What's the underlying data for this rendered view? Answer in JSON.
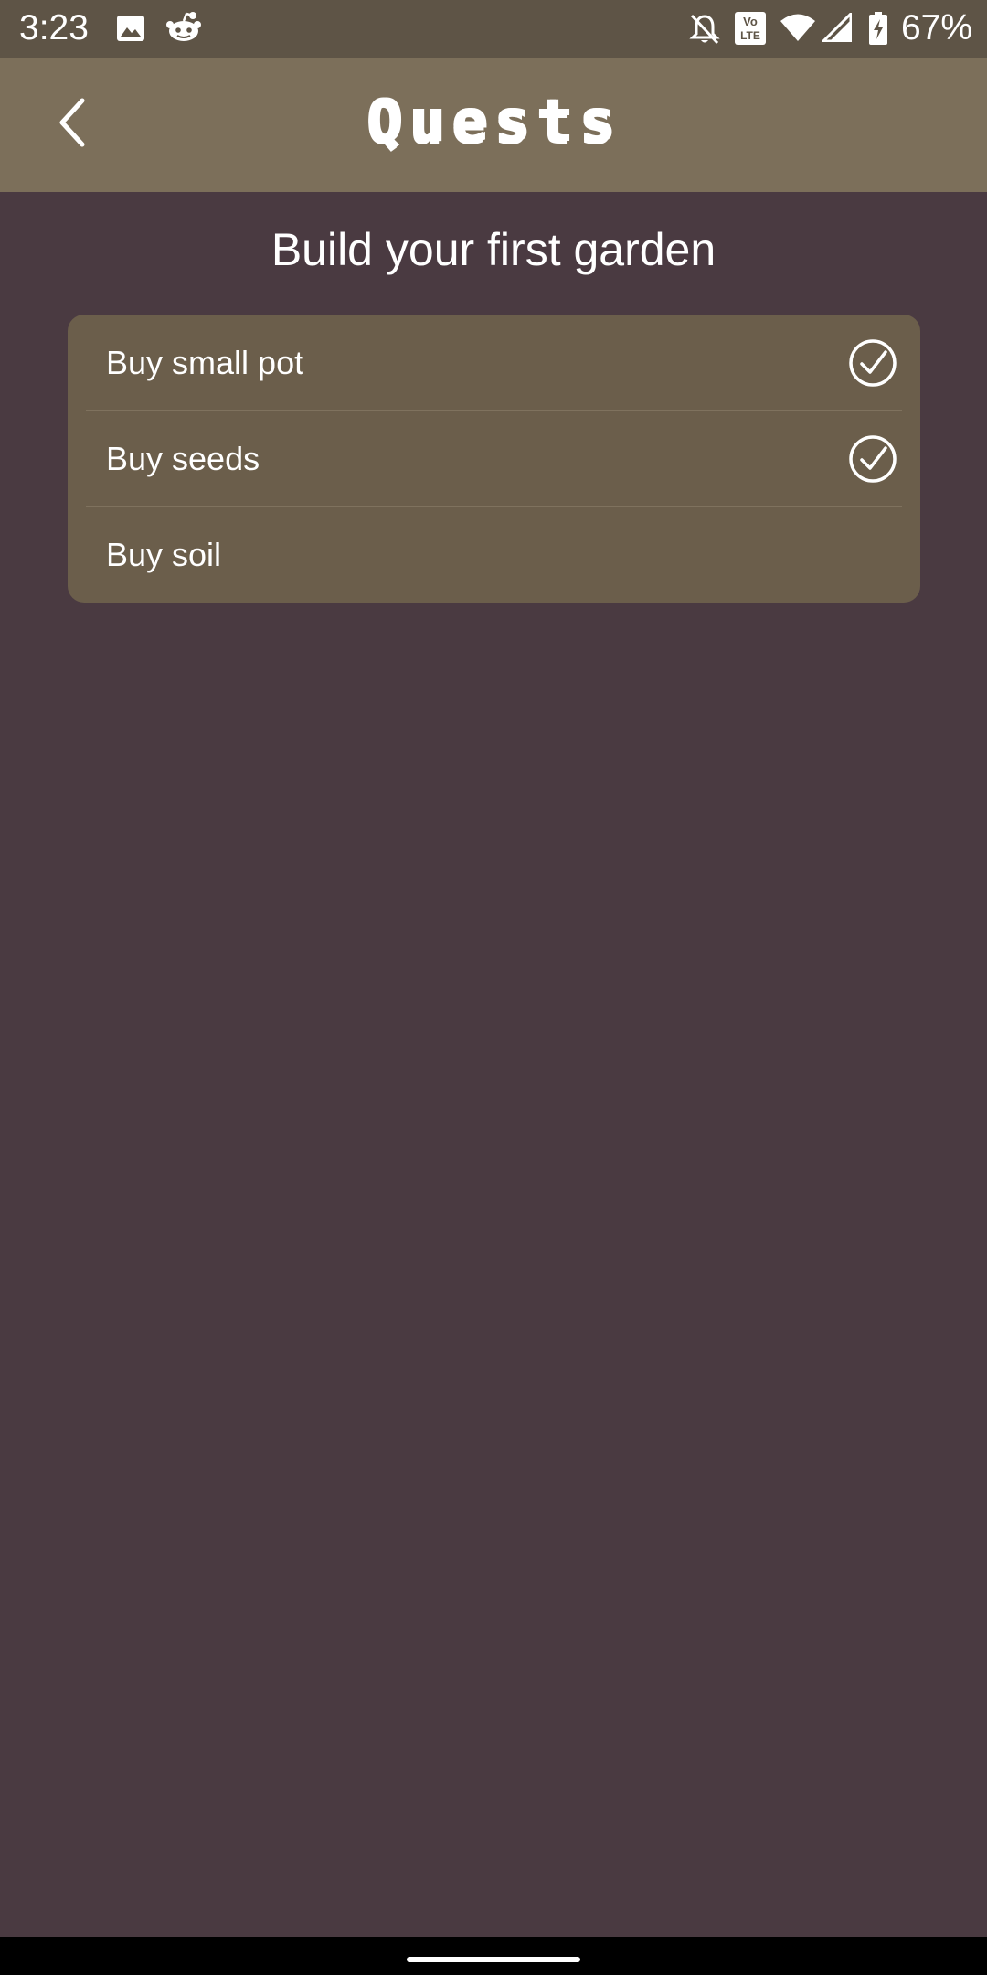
{
  "status_bar": {
    "time": "3:23",
    "battery_percent": "67%",
    "icons": [
      "image-icon",
      "reddit-icon",
      "notifications-off-icon",
      "volte-icon",
      "wifi-icon",
      "signal-icon",
      "battery-charging-icon"
    ]
  },
  "app_bar": {
    "title": "Quests",
    "back_icon": "chevron-left-icon"
  },
  "quest": {
    "title": "Build your first garden",
    "items": [
      {
        "label": "Buy small pot",
        "completed": true
      },
      {
        "label": "Buy seeds",
        "completed": true
      },
      {
        "label": "Buy soil",
        "completed": false
      }
    ]
  },
  "colors": {
    "background": "#4a3a41",
    "app_bar": "#7c6f5a",
    "status_bar": "#5e5446",
    "card": "#6b5e4b"
  }
}
